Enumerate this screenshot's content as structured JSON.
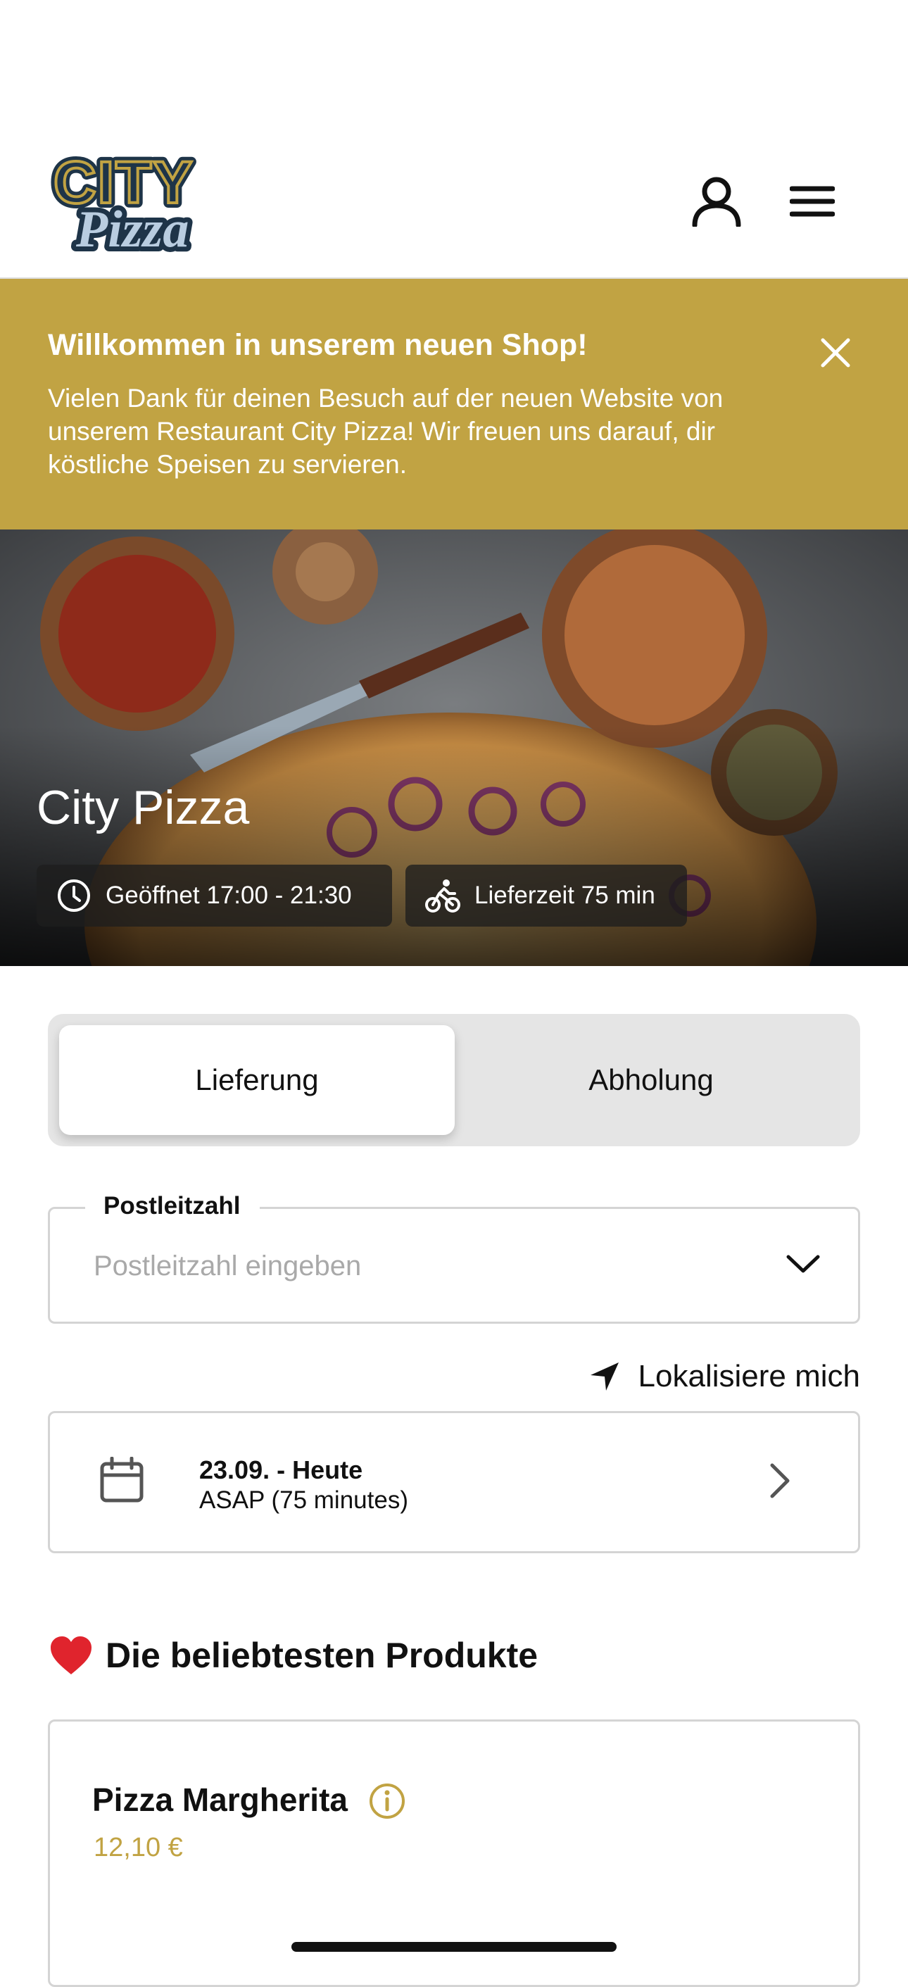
{
  "header": {
    "logo_top": "CITY",
    "logo_bottom": "Pizza"
  },
  "banner": {
    "title": "Willkommen in unserem neuen Shop!",
    "text": "Vielen Dank für deinen Besuch auf der neuen Website von unserem Restaurant City Pizza! Wir freuen uns darauf, dir köstliche Speisen zu servieren."
  },
  "hero": {
    "title": "City Pizza",
    "opening_hours": "Geöffnet 17:00 - 21:30",
    "delivery_time": "Lieferzeit 75 min"
  },
  "order_mode": {
    "options": [
      "Lieferung",
      "Abholung"
    ],
    "selected": "Lieferung"
  },
  "postcode": {
    "label": "Postleitzahl",
    "placeholder": "Postleitzahl eingeben",
    "value": ""
  },
  "locate": {
    "label": "Lokalisiere mich"
  },
  "schedule": {
    "date": "23.09. - Heute",
    "time": "ASAP (75 minutes)"
  },
  "popular": {
    "emoji": "❤️",
    "heading": "Die beliebtesten Produkte",
    "products": [
      {
        "name": "Pizza Margherita",
        "price": "12,10 €"
      }
    ]
  },
  "colors": {
    "accent": "#c1a343",
    "logo_navy": "#1e3448",
    "toggle_bg": "#e5e5e5"
  },
  "icons": [
    "user-icon",
    "menu-icon",
    "close-icon",
    "clock-icon",
    "bicycle-icon",
    "chevron-down-icon",
    "location-arrow-icon",
    "calendar-icon",
    "chevron-right-icon",
    "heart-emoji",
    "info-icon"
  ]
}
